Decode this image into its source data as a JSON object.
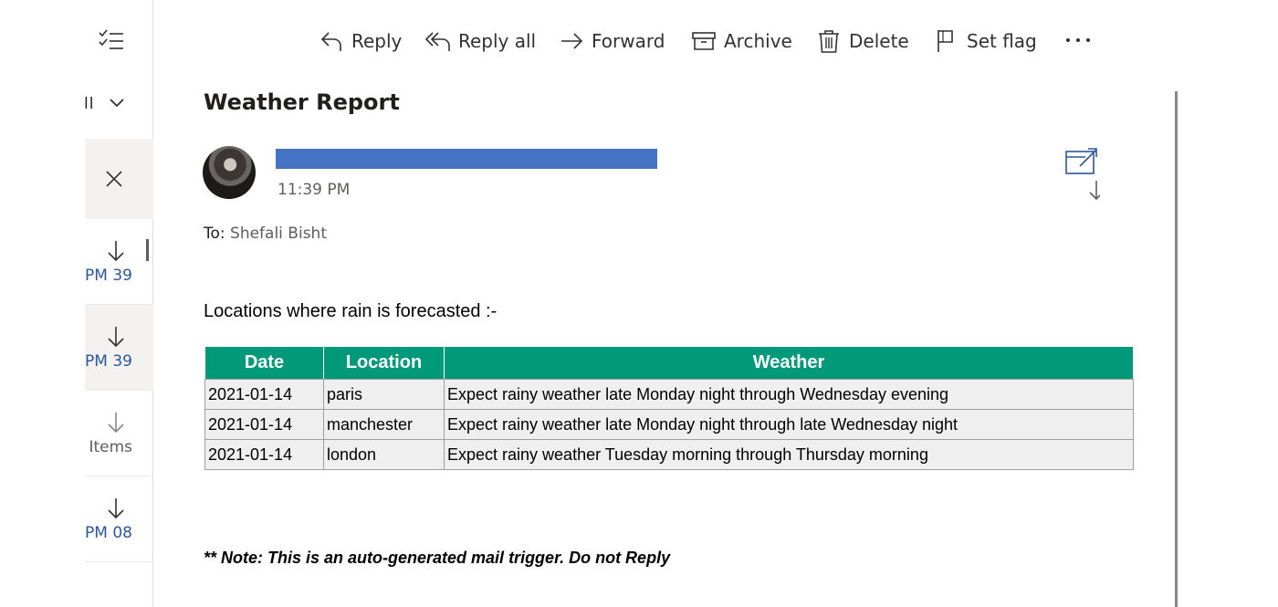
{
  "list": {
    "filter_label": "ll",
    "items": [
      {
        "time": "39 PM"
      },
      {
        "time": "39 PM"
      },
      {
        "time": "Items"
      },
      {
        "time": "08 PM"
      }
    ]
  },
  "toolbar": {
    "reply": "Reply",
    "reply_all": "Reply all",
    "forward": "Forward",
    "archive": "Archive",
    "delete": "Delete",
    "set_flag": "Set flag"
  },
  "message": {
    "subject": "Weather Report",
    "time": "11:39 PM",
    "to_label": "To:",
    "to_name": "Shefali Bisht",
    "intro": "Locations where rain is forecasted :-",
    "table": {
      "headers": [
        "Date",
        "Location",
        "Weather"
      ],
      "rows": [
        [
          "2021-01-14",
          "paris",
          "Expect rainy weather late Monday night through Wednesday evening"
        ],
        [
          "2021-01-14",
          "manchester",
          "Expect rainy weather late Monday night through late Wednesday night"
        ],
        [
          "2021-01-14",
          "london",
          "Expect rainy weather Tuesday morning through Thursday morning"
        ]
      ]
    },
    "note": "** Note: This is an auto-generated mail trigger. Do not Reply"
  },
  "colors": {
    "table_header": "#00997a",
    "link_blue": "#2b579a",
    "redaction": "#4472c4"
  }
}
